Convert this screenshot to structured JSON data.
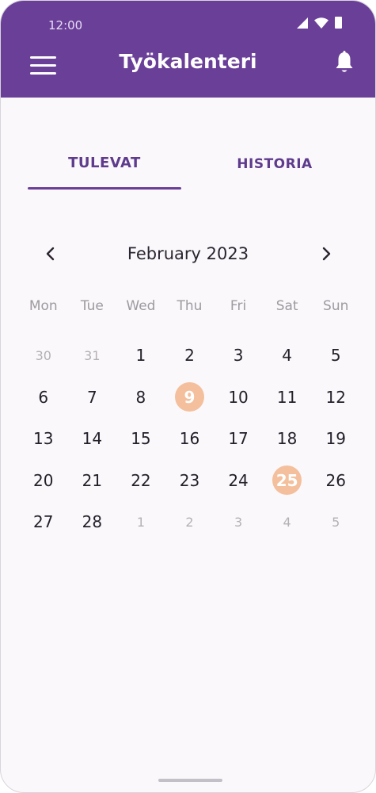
{
  "status_bar": {
    "time": "12:00"
  },
  "app_bar": {
    "title": "Työkalenteri"
  },
  "tabs": [
    {
      "label": "TULEVAT",
      "selected": true
    },
    {
      "label": "HISTORIA",
      "selected": false
    }
  ],
  "calendar": {
    "month_label": "February 2023",
    "weekdays": [
      "Mon",
      "Tue",
      "Wed",
      "Thu",
      "Fri",
      "Sat",
      "Sun"
    ],
    "weeks": [
      [
        {
          "d": "30",
          "muted": true
        },
        {
          "d": "31",
          "muted": true
        },
        {
          "d": "1"
        },
        {
          "d": "2"
        },
        {
          "d": "3"
        },
        {
          "d": "4"
        },
        {
          "d": "5"
        }
      ],
      [
        {
          "d": "6"
        },
        {
          "d": "7"
        },
        {
          "d": "8"
        },
        {
          "d": "9",
          "marked": true
        },
        {
          "d": "10"
        },
        {
          "d": "11"
        },
        {
          "d": "12"
        }
      ],
      [
        {
          "d": "13"
        },
        {
          "d": "14"
        },
        {
          "d": "15"
        },
        {
          "d": "16"
        },
        {
          "d": "17"
        },
        {
          "d": "18"
        },
        {
          "d": "19"
        }
      ],
      [
        {
          "d": "20"
        },
        {
          "d": "21"
        },
        {
          "d": "22"
        },
        {
          "d": "23"
        },
        {
          "d": "24"
        },
        {
          "d": "25",
          "marked": true
        },
        {
          "d": "26"
        }
      ],
      [
        {
          "d": "27"
        },
        {
          "d": "28"
        },
        {
          "d": "1",
          "muted": true
        },
        {
          "d": "2",
          "muted": true
        },
        {
          "d": "3",
          "muted": true
        },
        {
          "d": "4",
          "muted": true
        },
        {
          "d": "5",
          "muted": true
        }
      ]
    ]
  },
  "colors": {
    "primary": "#6a3f98",
    "marked_day": "#f4bf9c",
    "background": "#fbf8fb"
  },
  "icons": {
    "menu": "menu-icon",
    "notifications": "bell-icon",
    "prev_month": "chevron-left-icon",
    "next_month": "chevron-right-icon"
  }
}
